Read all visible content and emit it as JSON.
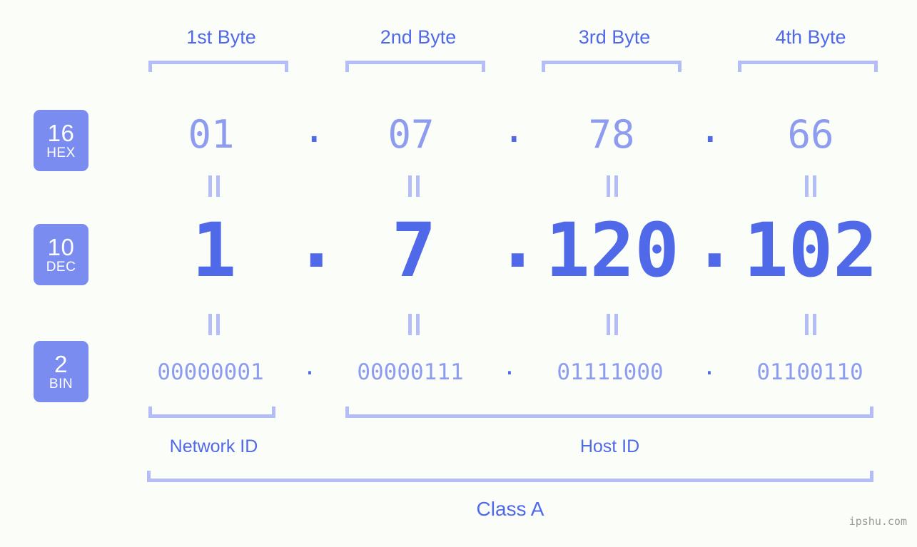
{
  "meta": {
    "background_color": "#fbfdf9",
    "accent_strong": "#5069e8",
    "accent_mid": "#7b8cf0",
    "accent_light": "#8e9cf0",
    "accent_pale": "#b5bdf8",
    "watermark": "ipshu.com"
  },
  "byte_headers": [
    {
      "label": "1st Byte"
    },
    {
      "label": "2nd Byte"
    },
    {
      "label": "3rd Byte"
    },
    {
      "label": "4th Byte"
    }
  ],
  "bases": [
    {
      "radix": "16",
      "name": "HEX"
    },
    {
      "radix": "10",
      "name": "DEC"
    },
    {
      "radix": "2",
      "name": "BIN"
    }
  ],
  "rows": {
    "hex": {
      "radix": "16",
      "name": "HEX",
      "values": [
        "01",
        "07",
        "78",
        "66"
      ],
      "separator": "."
    },
    "dec": {
      "radix": "10",
      "name": "DEC",
      "values": [
        "1",
        "7",
        "120",
        "102"
      ],
      "separator": ".",
      "address": "1.7.120.102"
    },
    "bin": {
      "radix": "2",
      "name": "BIN",
      "values": [
        "00000001",
        "00000111",
        "01111000",
        "01100110"
      ],
      "separator": "."
    }
  },
  "equivalence_mark": "=",
  "segments": [
    {
      "label": "Network ID"
    },
    {
      "label": "Host ID"
    }
  ],
  "class": {
    "label": "Class A"
  }
}
